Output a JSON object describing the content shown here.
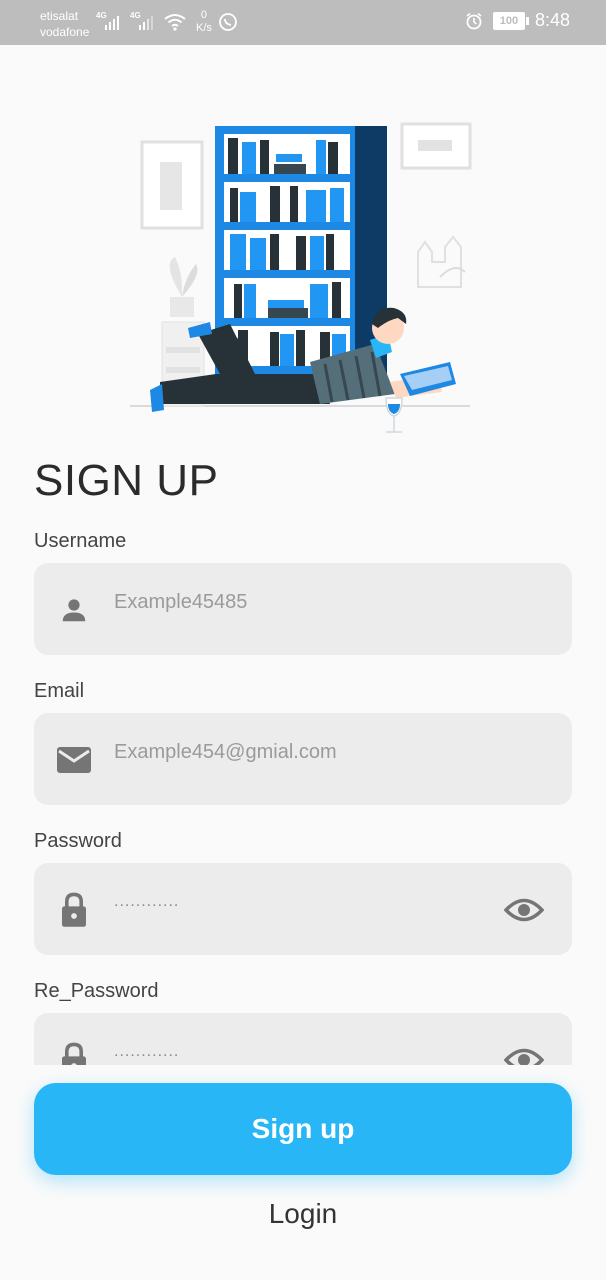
{
  "status_bar": {
    "carrier_1": "etisalat",
    "carrier_2": "vodafone",
    "net_1": "4G",
    "net_2": "4G",
    "speed_value": "0",
    "speed_unit": "K/s",
    "battery": "100",
    "time": "8:48"
  },
  "page": {
    "title": "SIGN UP"
  },
  "form": {
    "username": {
      "label": "Username",
      "placeholder": "Example45485"
    },
    "email": {
      "label": "Email",
      "placeholder": "Example454@gmial.com"
    },
    "password": {
      "label": "Password",
      "masked": "............"
    },
    "re_password": {
      "label": "Re_Password",
      "masked": "............"
    }
  },
  "actions": {
    "signup_label": "Sign up",
    "login_label": "Login"
  },
  "colors": {
    "accent": "#29b6f6",
    "field_bg": "#ececec",
    "illustration_blue": "#1e88e5"
  }
}
